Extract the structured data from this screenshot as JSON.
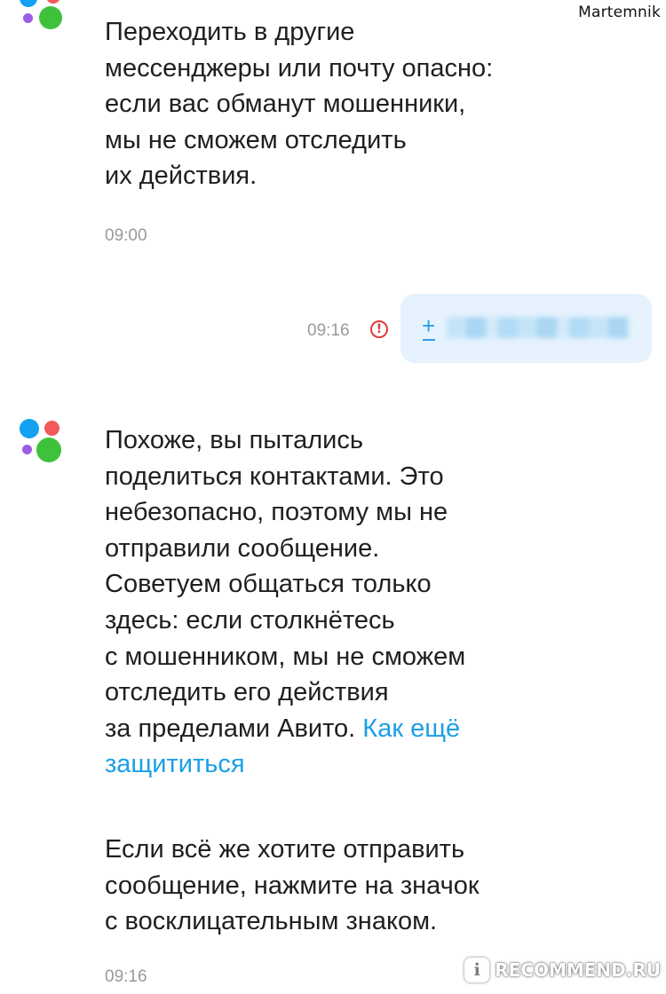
{
  "watermark_top": "Martemnik",
  "messages": [
    {
      "text": "Переходить в другие\nмессенджеры или почту опасно:\nесли вас обманут мошенники,\nмы не сможем отследить\nих действия.",
      "time": "09:00"
    },
    {
      "outgoing": true,
      "prefix": "+",
      "time": "09:16",
      "status_icon": "exclamation-circle-icon"
    },
    {
      "text_main": "Похоже, вы пытались\nподелиться контактами. Это\nнебезопасно, поэтому мы не\nотправили сообщение.\nСоветуем общаться только\nздесь: если столкнётесь\nс мошенником, мы не сможем\nотследить его действия\nза пределами Авито. ",
      "link": "Как ещё\nзащититься",
      "text_extra": "Если всё же хотите отправить\nсообщение, нажмите на значок\nс восклицательным знаком.",
      "time": "09:16"
    }
  ],
  "watermark_bottom": {
    "logo_letter": "i",
    "text": "RECOMMEND.RU"
  },
  "colors": {
    "link": "#1aa0e6",
    "out_bubble": "#e6f2fd",
    "warning": "#e43b3b",
    "avatar_blue": "#14a2f0",
    "avatar_red": "#f25a5a",
    "avatar_purple": "#9b5de5",
    "avatar_green": "#3ec23b"
  }
}
